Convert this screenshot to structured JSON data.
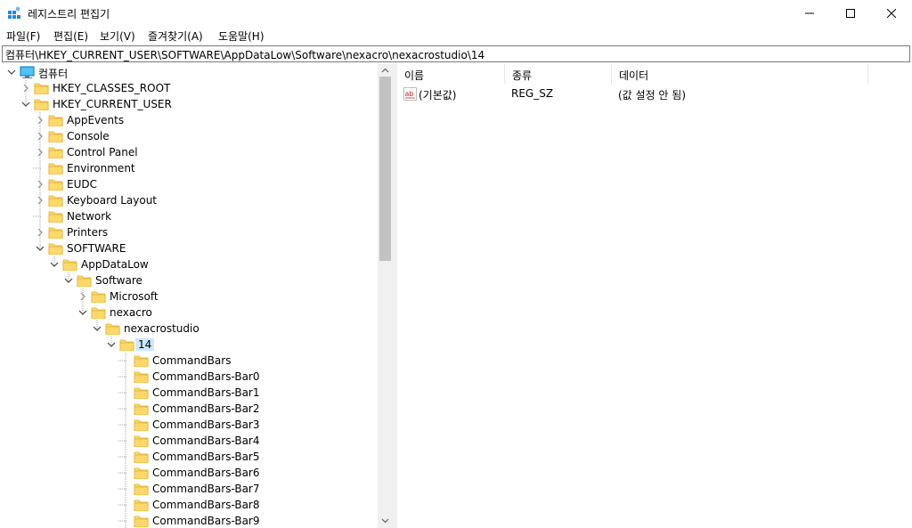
{
  "window": {
    "title": "레지스트리 편집기"
  },
  "menu": [
    "파일(F)",
    "편집(E)",
    "보기(V)",
    "즐겨찾기(A)",
    "도움말(H)"
  ],
  "address": "컴퓨터\\HKEY_CURRENT_USER\\SOFTWARE\\AppDataLow\\Software\\nexacro\\nexacrostudio\\14",
  "tree": [
    {
      "label": "컴퓨터",
      "level": 0,
      "expander": "open",
      "icon": "computer-icon"
    },
    {
      "label": "HKEY_CLASSES_ROOT",
      "level": 1,
      "expander": "closed"
    },
    {
      "label": "HKEY_CURRENT_USER",
      "level": 1,
      "expander": "open"
    },
    {
      "label": "AppEvents",
      "level": 2,
      "expander": "closed"
    },
    {
      "label": "Console",
      "level": 2,
      "expander": "closed"
    },
    {
      "label": "Control Panel",
      "level": 2,
      "expander": "closed"
    },
    {
      "label": "Environment",
      "level": 2,
      "expander": "none"
    },
    {
      "label": "EUDC",
      "level": 2,
      "expander": "closed"
    },
    {
      "label": "Keyboard Layout",
      "level": 2,
      "expander": "closed"
    },
    {
      "label": "Network",
      "level": 2,
      "expander": "none"
    },
    {
      "label": "Printers",
      "level": 2,
      "expander": "closed"
    },
    {
      "label": "SOFTWARE",
      "level": 2,
      "expander": "open"
    },
    {
      "label": "AppDataLow",
      "level": 3,
      "expander": "open"
    },
    {
      "label": "Software",
      "level": 4,
      "expander": "open"
    },
    {
      "label": "Microsoft",
      "level": 5,
      "expander": "closed"
    },
    {
      "label": "nexacro",
      "level": 5,
      "expander": "open"
    },
    {
      "label": "nexacrostudio",
      "level": 6,
      "expander": "open"
    },
    {
      "label": "14",
      "level": 7,
      "expander": "open",
      "selected": true
    },
    {
      "label": "CommandBars",
      "level": 8,
      "expander": "none"
    },
    {
      "label": "CommandBars-Bar0",
      "level": 8,
      "expander": "none"
    },
    {
      "label": "CommandBars-Bar1",
      "level": 8,
      "expander": "none"
    },
    {
      "label": "CommandBars-Bar2",
      "level": 8,
      "expander": "none"
    },
    {
      "label": "CommandBars-Bar3",
      "level": 8,
      "expander": "none"
    },
    {
      "label": "CommandBars-Bar4",
      "level": 8,
      "expander": "none"
    },
    {
      "label": "CommandBars-Bar5",
      "level": 8,
      "expander": "none"
    },
    {
      "label": "CommandBars-Bar6",
      "level": 8,
      "expander": "none"
    },
    {
      "label": "CommandBars-Bar7",
      "level": 8,
      "expander": "none"
    },
    {
      "label": "CommandBars-Bar8",
      "level": 8,
      "expander": "none"
    },
    {
      "label": "CommandBars-Bar9",
      "level": 8,
      "expander": "none"
    }
  ],
  "list": {
    "columns": [
      "이름",
      "종류",
      "데이터"
    ],
    "rows": [
      {
        "name": "(기본값)",
        "type": "REG_SZ",
        "data": "(값 설정 안 됨)",
        "icon": "string-value-icon"
      }
    ]
  },
  "colors": {
    "selection": "#cce8ff",
    "folder": "#ffd96a",
    "folder_edge": "#e0b030"
  }
}
